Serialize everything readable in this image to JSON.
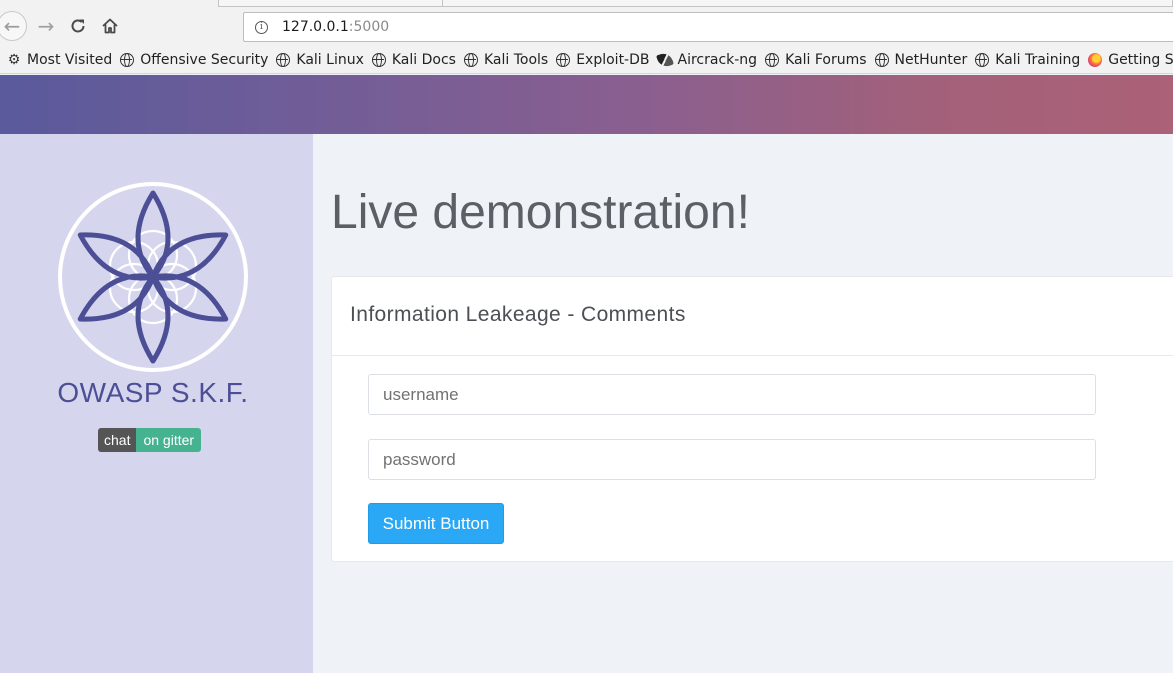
{
  "browser": {
    "url_host": "127.0.0.1",
    "url_port": ":5000",
    "bookmarks": [
      {
        "label": "Most Visited",
        "icon": "gear-icon"
      },
      {
        "label": "Offensive Security",
        "icon": "globe-icon"
      },
      {
        "label": "Kali Linux",
        "icon": "globe-icon"
      },
      {
        "label": "Kali Docs",
        "icon": "globe-icon"
      },
      {
        "label": "Kali Tools",
        "icon": "globe-icon"
      },
      {
        "label": "Exploit-DB",
        "icon": "globe-icon"
      },
      {
        "label": "Aircrack-ng",
        "icon": "aircrack-icon"
      },
      {
        "label": "Kali Forums",
        "icon": "globe-icon"
      },
      {
        "label": "NetHunter",
        "icon": "globe-icon"
      },
      {
        "label": "Kali Training",
        "icon": "globe-icon"
      },
      {
        "label": "Getting Started",
        "icon": "firefox-icon"
      }
    ]
  },
  "sidebar": {
    "brand": "OWASP S.K.F.",
    "badge_left": "chat",
    "badge_right": "on gitter"
  },
  "main": {
    "title": "Live demonstration!",
    "card_title": "Information Leakeage - Comments",
    "username_placeholder": "username",
    "password_placeholder": "password",
    "submit_label": "Submit Button"
  },
  "colors": {
    "brand": "#4d4f96",
    "sidebar_bg": "#d5d6ee",
    "button": "#2aa7f5",
    "gitter_green": "#46b390"
  }
}
